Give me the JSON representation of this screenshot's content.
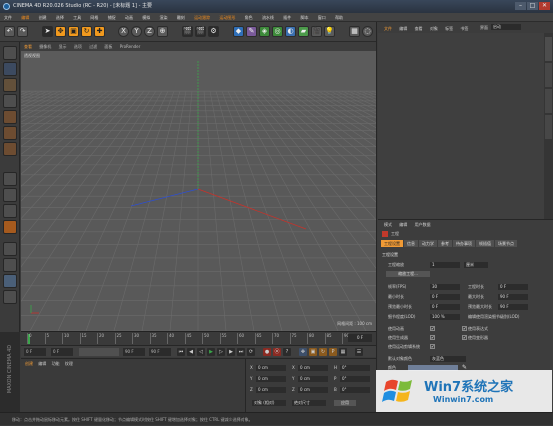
{
  "window": {
    "title": "CINEMA 4D R20.026 Studio (RC - R20) - [未标题 1] - 主要",
    "minimize": "–",
    "maximize": "□",
    "close": "✕"
  },
  "menu": [
    "文件",
    "编辑",
    "创建",
    "选择",
    "工具",
    "网格",
    "捕捉",
    "动画",
    "模拟",
    "渲染",
    "雕刻",
    "运动跟踪",
    "运动图形",
    "角色",
    "流水线",
    "插件",
    "脚本",
    "窗口",
    "帮助"
  ],
  "layout": {
    "label": "界面",
    "value": "启动"
  },
  "toolbar": {
    "undo": "↶",
    "redo": "↷",
    "axes": [
      "X",
      "Y",
      "Z"
    ]
  },
  "viewport": {
    "tabs": [
      "查看",
      "摄像机",
      "显示",
      "选项",
      "过滤",
      "面板",
      "ProRender"
    ],
    "label": "透视视图",
    "grid_spacing": "网格间距 : 100 cm"
  },
  "timeline": {
    "ticks": [
      "0",
      "5",
      "10",
      "15",
      "20",
      "25",
      "30",
      "35",
      "40",
      "45",
      "50",
      "55",
      "60",
      "65",
      "70",
      "75",
      "80",
      "85",
      "90"
    ],
    "frame_badge": "0 F"
  },
  "playback": {
    "start": "0 F",
    "current": "0 F",
    "end": "90 F",
    "end2": "90 F"
  },
  "materials": {
    "menu": [
      "创建",
      "编辑",
      "功能",
      "纹理"
    ]
  },
  "coords": {
    "rows": [
      {
        "a": "X",
        "av": "0 cm",
        "b": "X",
        "bv": "0 cm",
        "c": "H",
        "cv": "0°"
      },
      {
        "a": "Y",
        "av": "0 cm",
        "b": "Y",
        "bv": "0 cm",
        "c": "P",
        "cv": "0°"
      },
      {
        "a": "Z",
        "av": "0 cm",
        "b": "Z",
        "bv": "0 cm",
        "c": "B",
        "cv": "0°"
      }
    ],
    "mode": "对象 (相对)",
    "size_mode": "绝对尺寸",
    "apply": "应用"
  },
  "brand": "MAXON CINEMA 4D",
  "object_manager": {
    "menu": [
      "文件",
      "编辑",
      "查看",
      "对象",
      "标签",
      "书签"
    ]
  },
  "attributes": {
    "menu": [
      "模式",
      "编辑",
      "用户数据"
    ],
    "title": "工程",
    "tabs": [
      "工程设置",
      "信息",
      "动力学",
      "参考",
      "待办事项",
      "帧插值",
      "场景节点"
    ],
    "section": "工程设置",
    "scale_label": "工程缩放",
    "scale_value": "1",
    "scale_unit": "厘米",
    "scale_button": "缩放工程...",
    "fields": [
      {
        "label": "帧率(FPS)",
        "value": "30",
        "label2": "工程时长",
        "value2": "0 F"
      },
      {
        "label": "最小时长",
        "value": "0 F",
        "label2": "最大时长",
        "value2": "90 F"
      },
      {
        "label": "预览最小时长",
        "value": "0 F",
        "label2": "预览最大时长",
        "value2": "90 F"
      },
      {
        "label": "细节程度(LOD)",
        "value": "100 %",
        "label2": "编辑使用渲染细节级别(LOD)",
        "value2": ""
      }
    ],
    "checks": [
      {
        "label": "使用动画",
        "check": "✔",
        "label2": "使用表达式",
        "check2": "✔"
      },
      {
        "label": "使用生成器",
        "check": "✔",
        "label2": "使用变形器",
        "check2": "✔"
      },
      {
        "label": "使用运动剪辑系统",
        "check": "✔",
        "label2": "",
        "check2": ""
      }
    ],
    "color_label": "默认对象颜色",
    "color_value": "灰蓝色",
    "color2_label": "颜色"
  },
  "status": "移动：点击并拖动鼠标移动元素。按住 SHIFT 键量化移动；节点编辑模式时按住 SHIFT 键增加选择对象；按住 CTRL 键减少选择对象。",
  "watermark": {
    "title": "Win7系统之家",
    "url": "Winwin7.com"
  },
  "colors": {
    "accent": "#f09a35",
    "x_axis": "#c8322a",
    "y_axis": "#3aa64a",
    "z_axis": "#2e4fd0"
  }
}
